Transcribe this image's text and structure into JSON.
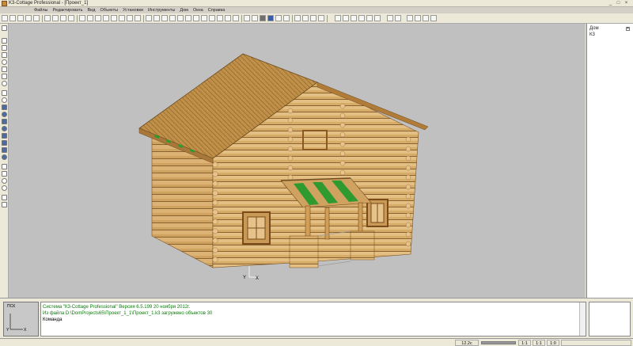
{
  "window": {
    "title": "K3-Cottage Professional - [Проект_1]",
    "controls": [
      "_",
      "□",
      "×"
    ]
  },
  "menu": [
    "Файлы",
    "Редактировать",
    "Вид",
    "Объекты",
    "Установки",
    "Инструменты",
    "Дом",
    "Окна",
    "Справка"
  ],
  "tree": {
    "root_label": "Дом",
    "child_label": "К3",
    "expand_glyph": "+"
  },
  "ucs": {
    "label": "ПСК",
    "axis_y": "Y",
    "axis_x": "X"
  },
  "viewport": {
    "axis_y": "Y",
    "axis_x": "X",
    "background": "#c0c0c0",
    "log_color": "#d4a96a",
    "roof_color": "#c99a52",
    "accent_green": "#2f9a2f"
  },
  "console": {
    "lines": [
      "Система \"К3-Cottage Professional\" Версия 6.5.199  20 ноября 2012г.",
      "Из файла D:\\DomProjects65\\Проект_1_1\\Проект_1.k3 загружено объектов 30",
      "Команда"
    ],
    "text_color": "#0a7a0a"
  },
  "status": {
    "zoom": "12.2с",
    "scale1": "1:1",
    "scale2": "1:1",
    "value3": "1:0"
  }
}
